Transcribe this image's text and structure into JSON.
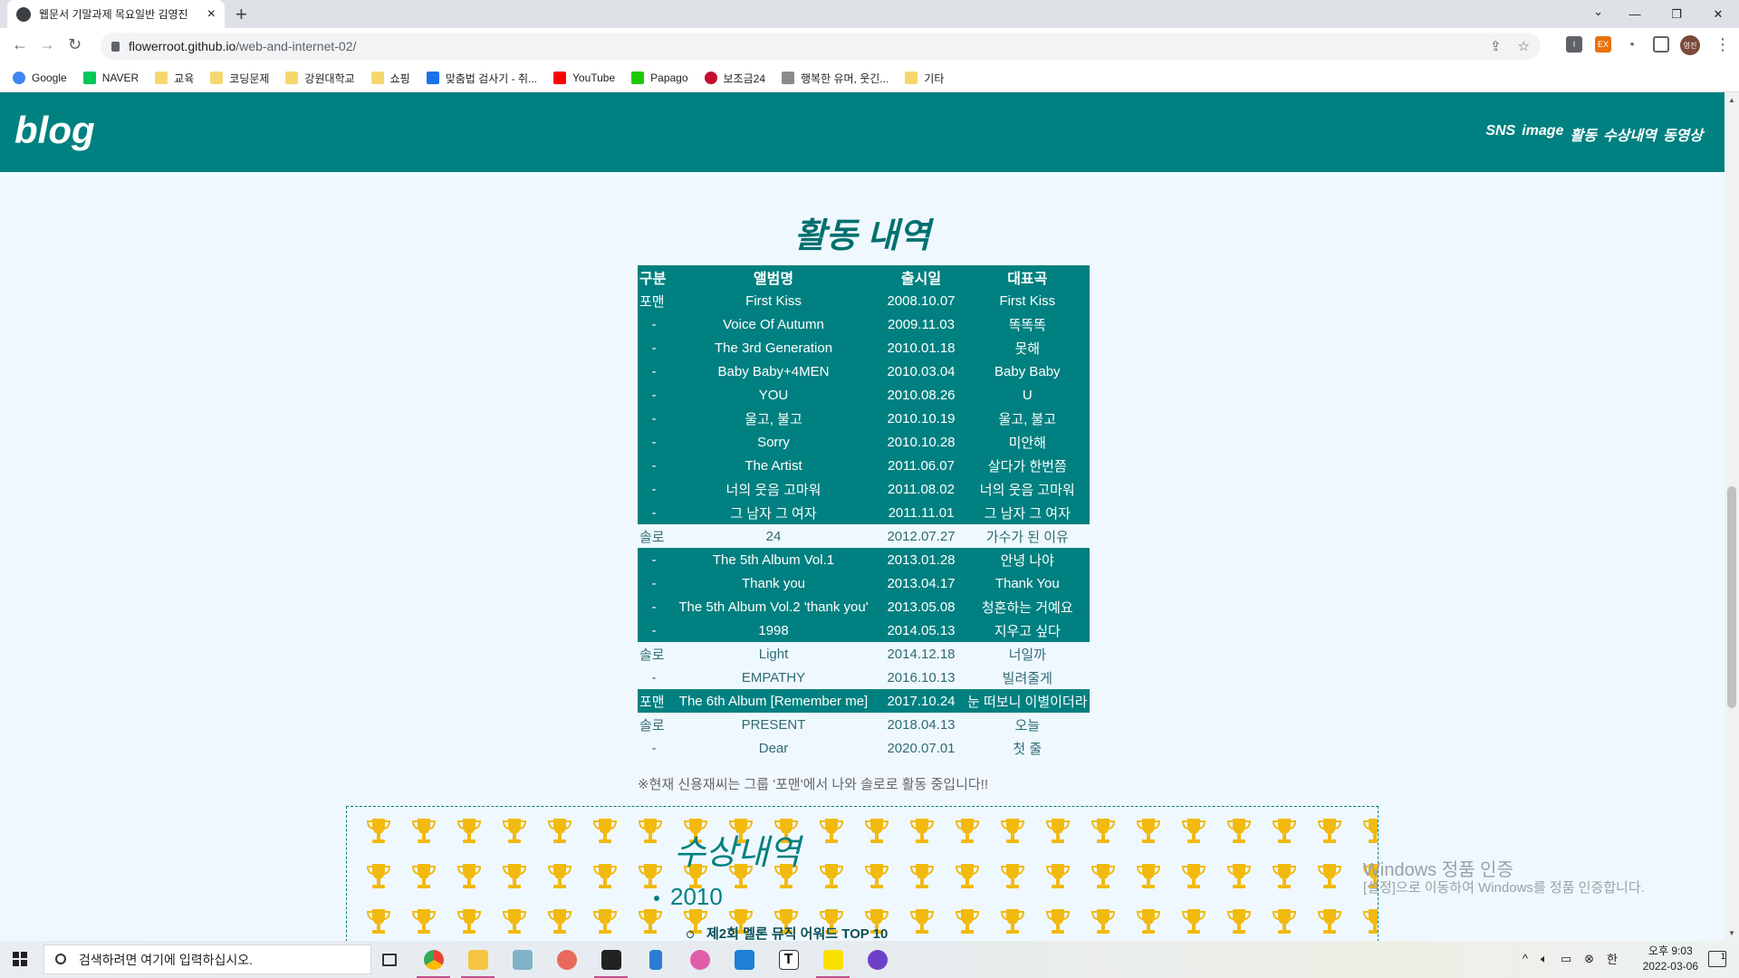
{
  "browser": {
    "tab_title": "웹문서 기말과제 목요일반 김영진",
    "url_host": "flowerroot.github.io",
    "url_path": "/web-and-internet-02/",
    "bookmarks": [
      "Google",
      "NAVER",
      "교육",
      "코딩문제",
      "강원대학교",
      "쇼핑",
      "맞춤법 검사기 - 취...",
      "YouTube",
      "Papago",
      "보조금24",
      "행복한 유머, 웃긴...",
      "기타"
    ],
    "avatar_text": "영진"
  },
  "site": {
    "logo": "blog",
    "nav": [
      "SNS",
      "image",
      "활동",
      "수상내역",
      "동영상"
    ]
  },
  "activity": {
    "title": "활동 내역",
    "headers": [
      "구분",
      "앨범명",
      "출시일",
      "대표곡"
    ],
    "rows": [
      [
        "포맨",
        "First Kiss",
        "2008.10.07",
        "First Kiss",
        "teal"
      ],
      [
        "-",
        "Voice Of Autumn",
        "2009.11.03",
        "똑똑똑",
        "teal"
      ],
      [
        "-",
        "The 3rd Generation",
        "2010.01.18",
        "못해",
        "teal"
      ],
      [
        "-",
        "Baby Baby+4MEN",
        "2010.03.04",
        "Baby Baby",
        "teal"
      ],
      [
        "-",
        "YOU",
        "2010.08.26",
        "U",
        "teal"
      ],
      [
        "-",
        "울고, 불고",
        "2010.10.19",
        "울고, 불고",
        "teal"
      ],
      [
        "-",
        "Sorry",
        "2010.10.28",
        "미안해",
        "teal"
      ],
      [
        "-",
        "The Artist",
        "2011.06.07",
        "살다가 한번쯤",
        "teal"
      ],
      [
        "-",
        "너의 웃음 고마워",
        "2011.08.02",
        "너의 웃음 고마워",
        "teal"
      ],
      [
        "-",
        "그 남자 그 여자",
        "2011.11.01",
        "그 남자 그 여자",
        "teal"
      ],
      [
        "솔로",
        "24",
        "2012.07.27",
        "가수가 된 이유",
        "plain"
      ],
      [
        "-",
        "The 5th Album Vol.1",
        "2013.01.28",
        "안녕 나야",
        "teal"
      ],
      [
        "-",
        "Thank you",
        "2013.04.17",
        "Thank You",
        "teal"
      ],
      [
        "-",
        "The 5th Album Vol.2 'thank you'",
        "2013.05.08",
        "청혼하는 거예요",
        "teal"
      ],
      [
        "-",
        "1998",
        "2014.05.13",
        "지우고 싶다",
        "teal"
      ],
      [
        "솔로",
        "Light",
        "2014.12.18",
        "너일까",
        "plain"
      ],
      [
        "-",
        "EMPATHY",
        "2016.10.13",
        "빌려줄게",
        "plain"
      ],
      [
        "포맨",
        "The 6th Album [Remember me]",
        "2017.10.24",
        "눈 떠보니 이별이더라",
        "teal"
      ],
      [
        "솔로",
        "PRESENT",
        "2018.04.13",
        "오늘",
        "plain"
      ],
      [
        "-",
        "Dear",
        "2020.07.01",
        "첫 줄",
        "plain"
      ]
    ],
    "note": "※현재 신용재씨는 그룹 '포맨'에서 나와 솔로로 활동 중입니다!!"
  },
  "awards": {
    "title": "수상내역",
    "year": "2010",
    "item": "제2회 멜론 뮤직 어워드 TOP 10"
  },
  "watermark": {
    "line1": "Windows 정품 인증",
    "line2": "[설정]으로 이동하여 Windows를 정품 인증합니다."
  },
  "taskbar": {
    "search_placeholder": "검색하려면 여기에 입력하십시오.",
    "ime": "한",
    "time": "오후 9:03",
    "date": "2022-03-06",
    "notifications": "1"
  },
  "colors": {
    "teal": "#008080",
    "page_bg": "#f0f8ff",
    "trophy": "#f2b90f"
  }
}
